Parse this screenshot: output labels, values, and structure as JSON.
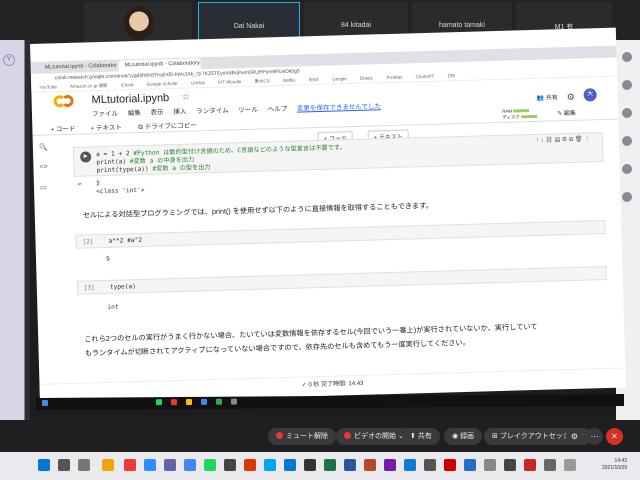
{
  "zoom": {
    "tiles": [
      {
        "name": "",
        "type": "video"
      },
      {
        "name": "Dai Nakai",
        "type": "active"
      },
      {
        "name": "84 kitadai",
        "type": "name"
      },
      {
        "name": "hamato tamaki",
        "type": "name"
      },
      {
        "name": "M1 有",
        "type": "name"
      }
    ],
    "controls": {
      "unmute": "ミュート解除",
      "start_video": "ビデオの開始",
      "share": "共有",
      "record": "録画",
      "breakout": "ブレイクアウトセッション"
    }
  },
  "browser": {
    "tabs": [
      "MLtutorial.ipynb - Colaboratory",
      "MLtutorial.ipynb - Colaboratory"
    ],
    "address": "colab.research.google.com/drive/1ygd9IWh8Yhq0Xf5-hWx3Ab_Qr7KZ5TEyoVdBqPwm0RUHPym9RUeDk0g5",
    "bookmarks": [
      "YouTube",
      "Amazon.co.jp 通販",
      "iCloud",
      "Google Scholar",
      "GitHub",
      "KIT Moodle",
      "東大CS",
      "Netflix",
      "IEEE",
      "Google",
      "DeepL",
      "ProBlas",
      "ChatGPT",
      "DRI"
    ]
  },
  "notebook": {
    "title": "MLtutorial.ipynb",
    "menu": [
      "ファイル",
      "編集",
      "表示",
      "挿入",
      "ランタイム",
      "ツール",
      "ヘルプ"
    ],
    "unsaved_warning": "変更を保存できませんでした",
    "share_label": "共有",
    "avatar_initial": "大",
    "toolbar": {
      "add_code": "+ コード",
      "add_text": "+ テキスト",
      "copy_to_drive": "ドライブにコピー",
      "ram": "RAM",
      "disk": "ディスク",
      "edit": "編集"
    },
    "floating": {
      "code": "+ コード",
      "text": "+ テキスト"
    },
    "cell1": {
      "lines": [
        {
          "code": "a = 1 + 2 ",
          "comment": "#Python は動的型付け言語のため、C言語などのような型宣言は不要です。"
        },
        {
          "code": "print(a) ",
          "comment": "#変数 a の中身を出力"
        },
        {
          "code": "print(type(a)) ",
          "comment": "#変数 a の型を出力"
        }
      ],
      "output": [
        "3",
        "<class 'int'>"
      ]
    },
    "paragraph1": "セルによる対話型プログラミングでは、print() を使用せず以下のように直接情報を取得することもできます。",
    "cell2": {
      "prompt": "[2]",
      "code": "a**2 #a^2",
      "output": "9"
    },
    "cell3": {
      "prompt": "[3]",
      "code": "type(a)",
      "output": "int"
    },
    "paragraph2_line1": "これら2つのセルの実行がうまく行かない場合、たいていは変数情報を依存するセル(今回でいう一番上)が実行されていないか、実行していて",
    "paragraph2_line2": "もランタイムが切断されてアクティブになっていない場合ですので、依存先のセルも含めてもう一度実行してください。",
    "status": "✓ 0 秒   完了時間: 14:43"
  },
  "host": {
    "time": "14:43",
    "date": "2021/10/29"
  },
  "colors": {
    "colab_orange": "#f9ab00",
    "zoom_blue": "#1fb3e8",
    "leave_red": "#d93025",
    "comment_green": "#298232"
  }
}
